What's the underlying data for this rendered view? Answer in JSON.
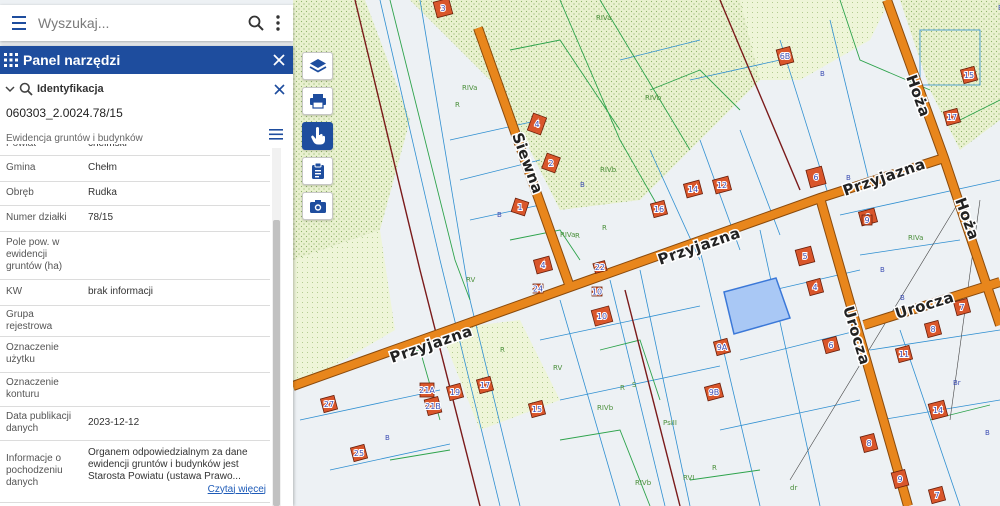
{
  "search": {
    "placeholder": "Wyszukaj..."
  },
  "panel": {
    "title": "Panel narzędzi",
    "section_label": "Identyfikacja",
    "parcel_id": "060303_2.0024.78/15",
    "layer_name": "Ewidencja gruntów i budynków",
    "attributes": [
      {
        "key": "Powiat",
        "value": "chełmski"
      },
      {
        "key": "Gmina",
        "value": "Chełm"
      },
      {
        "key": "Obręb",
        "value": "Rudka"
      },
      {
        "key": "Numer działki",
        "value": "78/15"
      },
      {
        "key": "Pole pow. w ewidencji gruntów (ha)",
        "value": ""
      },
      {
        "key": "KW",
        "value": "brak informacji"
      },
      {
        "key": "Grupa rejestrowa",
        "value": ""
      },
      {
        "key": "Oznaczenie użytku",
        "value": ""
      },
      {
        "key": "Oznaczenie konturu",
        "value": ""
      },
      {
        "key": "Data publikacji danych",
        "value": "2023-12-12"
      },
      {
        "key": "Informacje o pochodzeniu danych",
        "value": "Organem odpowiedzialnym za dane ewidencji gruntów i budynków jest Starosta Powiatu (ustawa Prawo..."
      }
    ],
    "read_more": "Czytaj więcej"
  },
  "tools": [
    {
      "name": "layers-tool-button",
      "icon": "layers-icon",
      "active": false
    },
    {
      "name": "print-tool-button",
      "icon": "printer-icon",
      "active": false
    },
    {
      "name": "identify-tool-button",
      "icon": "pointer-hand-icon",
      "active": true
    },
    {
      "name": "clipboard-tool-button",
      "icon": "clipboard-icon",
      "active": false
    },
    {
      "name": "camera-tool-button",
      "icon": "camera-icon",
      "active": false
    }
  ],
  "map": {
    "colors": {
      "road": "#e8861c",
      "road_edge": "#8a4a0c",
      "building": "#d9562b",
      "building_edge": "#6b1f0a",
      "selection": "#a9c8f5",
      "selection_edge": "#3b78d8",
      "parcel_line": "#2f8fd1",
      "landuse_line": "#2ea34c",
      "boundary_line": "#7a1a1a"
    },
    "streets": [
      "Siewna",
      "Przyjazna",
      "Przyjazna",
      "Przyjazna",
      "Hoża",
      "Hoża",
      "Urocza",
      "Urocza"
    ],
    "building_numbers": [
      "4",
      "2",
      "1",
      "4",
      "22",
      "24",
      "10",
      "14",
      "12",
      "16",
      "6",
      "6B",
      "9",
      "4",
      "5",
      "9",
      "6",
      "9A",
      "9B",
      "10",
      "7",
      "8",
      "11",
      "14",
      "15",
      "17",
      "3",
      "21A",
      "21B",
      "19",
      "17",
      "15",
      "27",
      "25",
      "8",
      "7",
      "9"
    ],
    "landuse_labels": [
      "R",
      "RIVa",
      "RIVb",
      "B",
      "S",
      "PsIII",
      "Br",
      "RV",
      "RVI",
      "dr"
    ]
  }
}
